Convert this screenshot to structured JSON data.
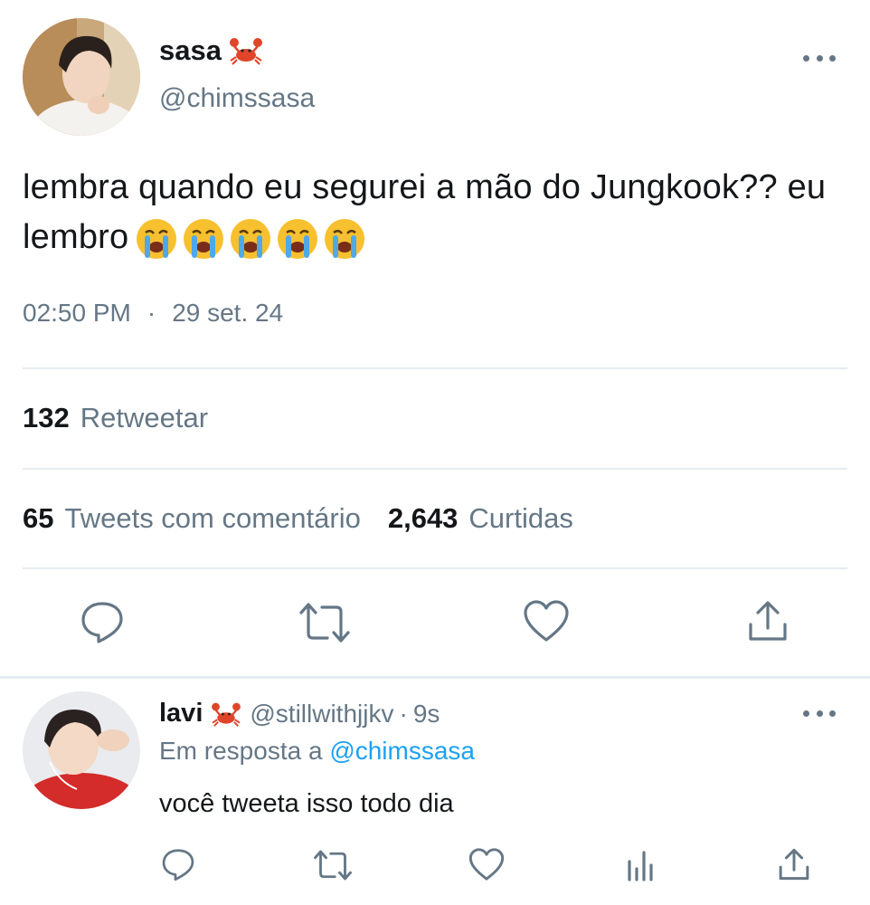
{
  "main_tweet": {
    "display_name": "sasa",
    "name_emoji": "crab-emoji",
    "handle": "@chimssasa",
    "text": "lembra quando eu segurei a mão do Jungkook?? eu lembro",
    "emoji_trail": [
      "loudly-crying-face",
      "loudly-crying-face",
      "loudly-crying-face",
      "loudly-crying-face",
      "loudly-crying-face"
    ],
    "time": "02:50 PM",
    "separator": "·",
    "date": "29 set. 24",
    "retweets_count": "132",
    "retweets_label": "Retweetar",
    "quote_count": "65",
    "quote_label": "Tweets com comentário",
    "likes_count": "2,643",
    "likes_label": "Curtidas",
    "actions": [
      "reply-icon",
      "retweet-icon",
      "like-icon",
      "share-icon"
    ]
  },
  "reply_tweet": {
    "display_name": "lavi",
    "name_emoji": "crab-emoji",
    "handle": "@stillwithjjkv",
    "separator": "·",
    "time_ago": "9s",
    "reply_prefix": "Em resposta a",
    "reply_mention": "@chimssasa",
    "text": "você tweeta isso todo dia",
    "actions": [
      "reply-icon",
      "retweet-icon",
      "like-icon",
      "analytics-icon",
      "share-icon"
    ]
  },
  "colors": {
    "text_primary": "#14171a",
    "text_secondary": "#657786",
    "link": "#1da1f2",
    "divider": "#e6ecf0"
  }
}
